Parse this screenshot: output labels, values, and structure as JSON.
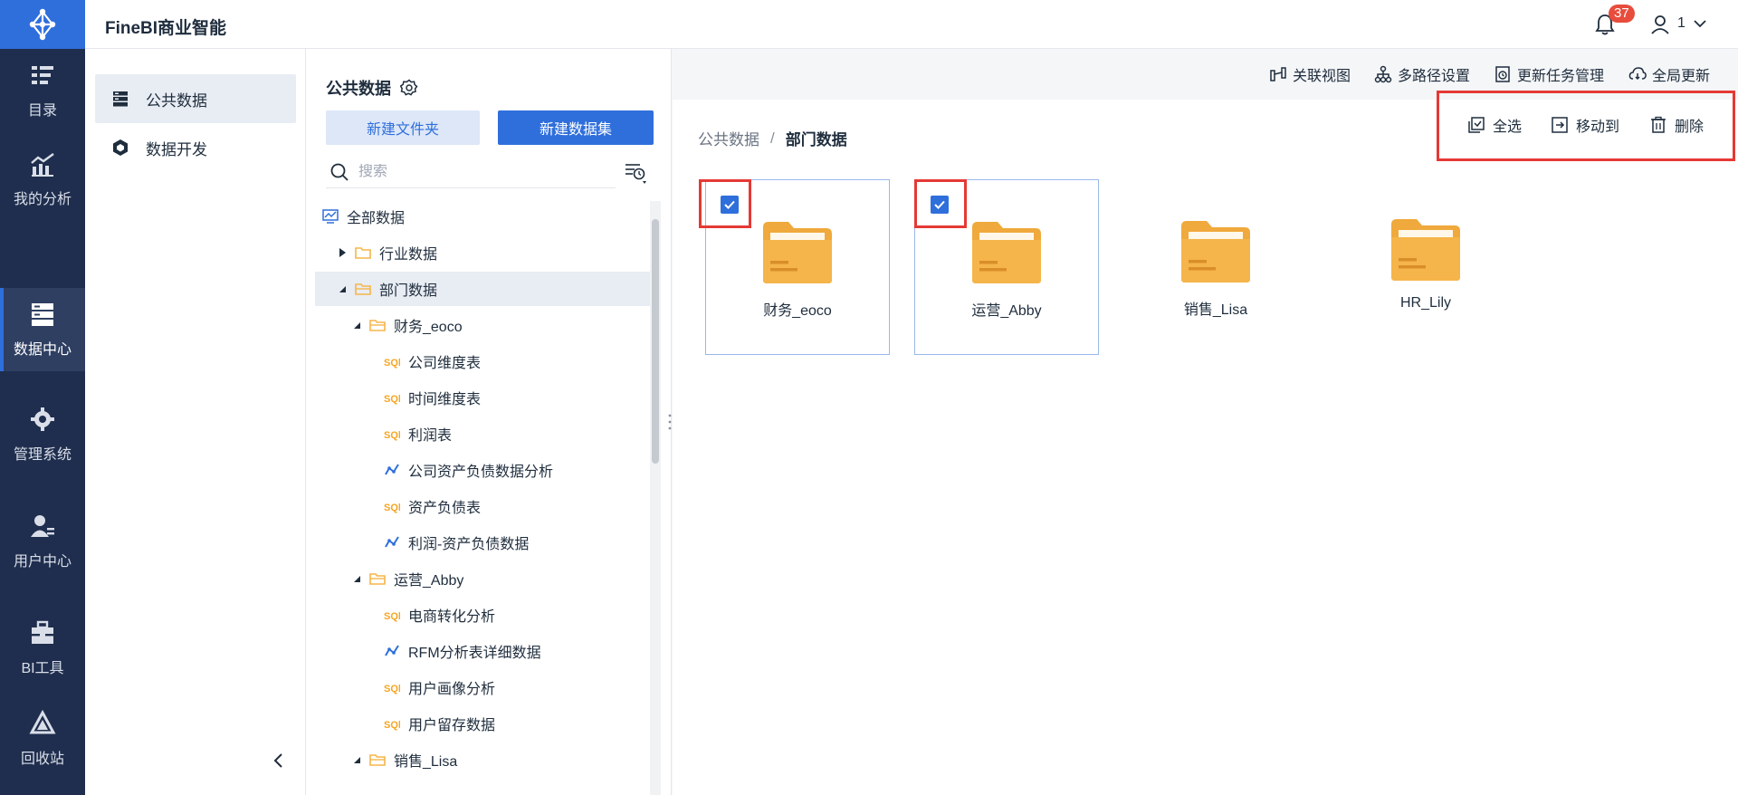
{
  "app": {
    "title": "FineBI商业智能"
  },
  "header": {
    "notification_count": "37",
    "user_name": "1"
  },
  "leftnav": {
    "items": [
      {
        "label": "目录",
        "icon": "catalog-icon"
      },
      {
        "label": "我的分析",
        "icon": "analysis-icon"
      },
      {
        "label": "数据中心",
        "icon": "data-center-icon",
        "active": true
      },
      {
        "label": "管理系统",
        "icon": "gear-icon"
      },
      {
        "label": "用户中心",
        "icon": "user-center-icon"
      },
      {
        "label": "BI工具",
        "icon": "toolbox-icon"
      },
      {
        "label": "回收站",
        "icon": "recycle-icon"
      }
    ]
  },
  "subnav": {
    "items": [
      {
        "label": "公共数据",
        "icon": "public-data-icon",
        "active": true
      },
      {
        "label": "数据开发",
        "icon": "data-dev-icon"
      }
    ]
  },
  "tree": {
    "title": "公共数据",
    "new_folder_label": "新建文件夹",
    "new_dataset_label": "新建数据集",
    "search_placeholder": "搜索",
    "rows": [
      {
        "label": "全部数据",
        "type": "root"
      },
      {
        "label": "行业数据",
        "type": "folder",
        "expanded": false
      },
      {
        "label": "部门数据",
        "type": "folder",
        "expanded": true,
        "selected": true
      },
      {
        "label": "财务_eoco",
        "type": "folder",
        "expanded": true
      },
      {
        "label": "公司维度表",
        "type": "sql"
      },
      {
        "label": "时间维度表",
        "type": "sql"
      },
      {
        "label": "利润表",
        "type": "sql"
      },
      {
        "label": "公司资产负债数据分析",
        "type": "analysis"
      },
      {
        "label": "资产负债表",
        "type": "sql"
      },
      {
        "label": "利润-资产负债数据",
        "type": "analysis"
      },
      {
        "label": "运营_Abby",
        "type": "folder",
        "expanded": true
      },
      {
        "label": "电商转化分析",
        "type": "sql"
      },
      {
        "label": "RFM分析表详细数据",
        "type": "analysis"
      },
      {
        "label": "用户画像分析",
        "type": "sql"
      },
      {
        "label": "用户留存数据",
        "type": "sql"
      },
      {
        "label": "销售_Lisa",
        "type": "folder",
        "expanded": true
      }
    ]
  },
  "toolbar": {
    "relation_view": "关联视图",
    "multipath": "多路径设置",
    "update_tasks": "更新任务管理",
    "global_update": "全局更新"
  },
  "breadcrumb": {
    "parent": "公共数据",
    "separator": "/",
    "current": "部门数据"
  },
  "actions": {
    "select_all": "全选",
    "move_to": "移动到",
    "delete": "删除"
  },
  "folders": [
    {
      "label": "财务_eoco",
      "checked": true
    },
    {
      "label": "运营_Abby",
      "checked": true
    },
    {
      "label": "销售_Lisa",
      "checked": false
    },
    {
      "label": "HR_Lily",
      "checked": false
    }
  ],
  "colors": {
    "brand": "#2f6fdc",
    "nav_bg": "#1f2e4e",
    "folder": "#f5b54a",
    "highlight": "#e53935"
  }
}
